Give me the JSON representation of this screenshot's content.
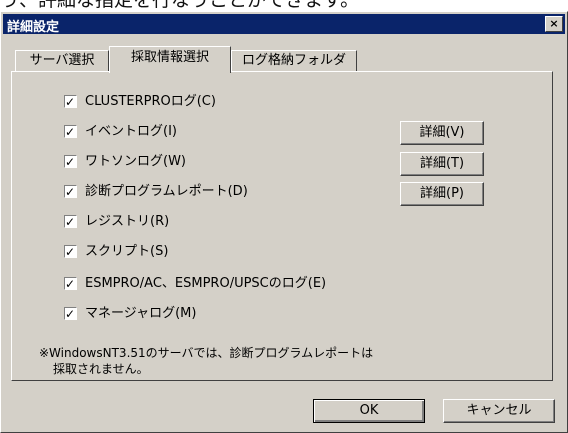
{
  "background_text": "う、評細な指定を行なうことができます。",
  "window": {
    "title": "詳細設定",
    "close_label": "×"
  },
  "tabs": [
    {
      "label": "サーバ選択"
    },
    {
      "label": "採取情報選択",
      "active": true
    },
    {
      "label": "ログ格納フォルダ"
    }
  ],
  "checkboxes": [
    {
      "label": "CLUSTERPROログ(C)",
      "checked": true
    },
    {
      "label": "イベントログ(I)",
      "checked": true
    },
    {
      "label": "ワトソンログ(W)",
      "checked": true
    },
    {
      "label": "診断プログラムレポート(D)",
      "checked": true
    },
    {
      "label": "レジストリ(R)",
      "checked": true
    },
    {
      "label": "スクリプト(S)",
      "checked": true
    },
    {
      "label": "ESMPRO/AC、ESMPRO/UPSCのログ(E)",
      "checked": true
    },
    {
      "label": "マネージャログ(M)",
      "checked": true
    }
  ],
  "detail_buttons": [
    {
      "label": "詳細(V)"
    },
    {
      "label": "詳細(T)"
    },
    {
      "label": "詳細(P)"
    }
  ],
  "note": {
    "line1": "※WindowsNT3.51のサーバでは、診断プログラムレポートは",
    "line2": "採取されません。"
  },
  "footer": {
    "ok_label": "OK",
    "cancel_label": "キャンセル"
  }
}
